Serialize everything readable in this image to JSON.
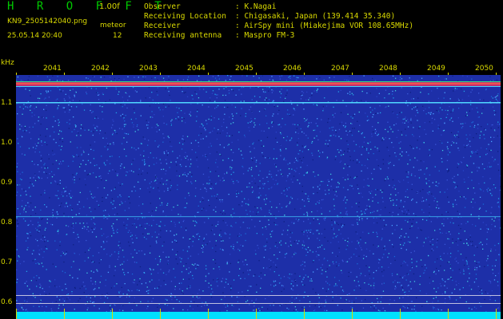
{
  "header": {
    "app_title": "H R O F F T",
    "version": "1.00f",
    "filename": "KN9_2505142040.png",
    "meteor_label": "meteor",
    "datetime": "25.05.14 20:40",
    "count": "12"
  },
  "station_info": [
    {
      "label": "Observer",
      "value": ": K.Nagai"
    },
    {
      "label": "Receiving Location",
      "value": ": Chigasaki, Japan (139.414 35.340)"
    },
    {
      "label": "Receiver",
      "value": ": AirSpy mini (Miakejima VOR 108.65MHz)"
    },
    {
      "label": "Receiving antenna",
      "value": ": Maspro FM-3"
    }
  ],
  "y_axis": {
    "unit": "kHz",
    "ticks": [
      "1.1",
      "1.0",
      "0.9",
      "0.8",
      "0.7",
      "0.6"
    ]
  },
  "x_axis": {
    "ticks": [
      "2041",
      "2042",
      "2043",
      "2044",
      "2045",
      "2046",
      "2047",
      "2048",
      "2049",
      "2050"
    ]
  },
  "colors": {
    "background": "#000000",
    "label": "#d8d800",
    "title": "#00c800",
    "noise_floor": "#1d2fa8",
    "carrier": "#ff4040",
    "bottom_band": "#00e0ff"
  }
}
